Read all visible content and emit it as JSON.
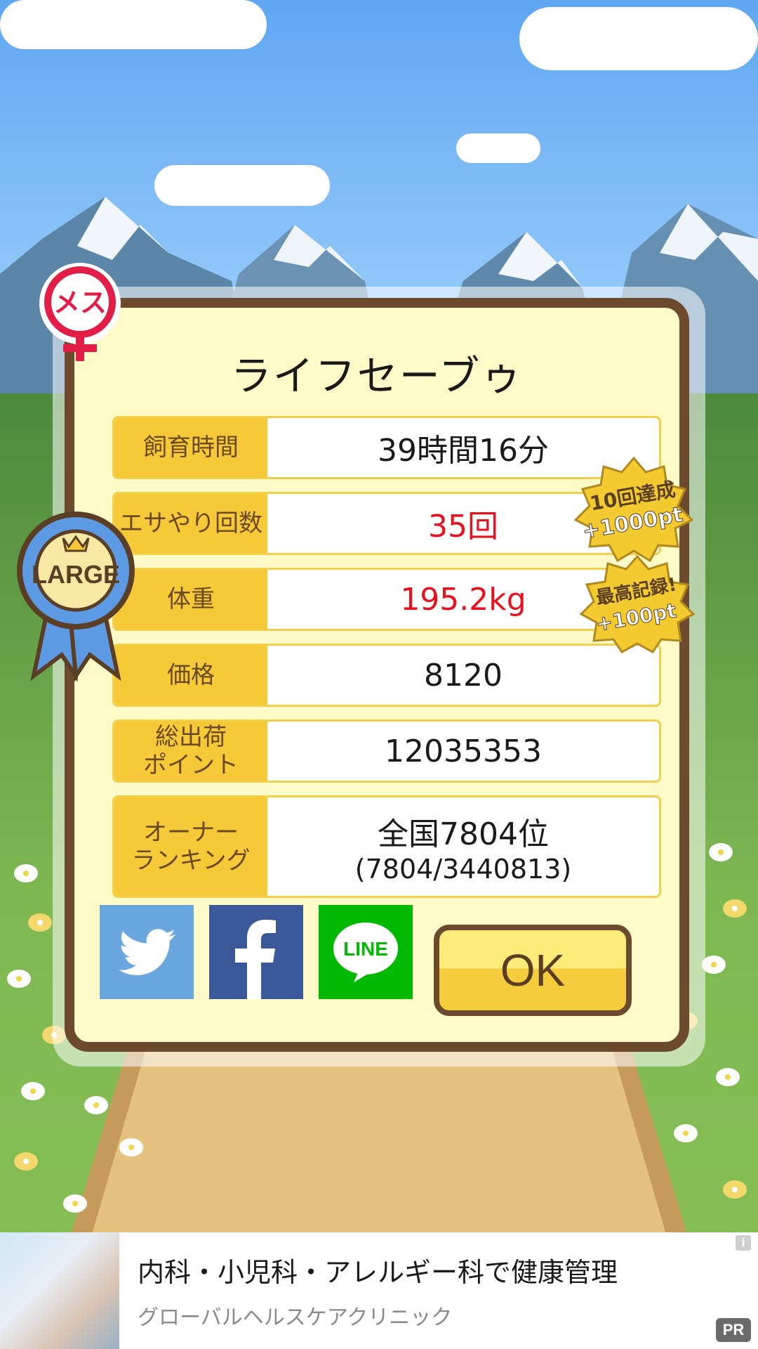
{
  "dialog": {
    "title": "ライフセーブゥ",
    "rows": [
      {
        "label": "飼育時間",
        "value": "39時間16分"
      },
      {
        "label": "エサやり回数",
        "value": "35回",
        "value_color": "#e8121e"
      },
      {
        "label": "体重",
        "value": "195.2kg",
        "value_color": "#e8121e"
      },
      {
        "label": "価格",
        "value": "8120"
      },
      {
        "label": "総出荷\nポイント",
        "value": "12035353"
      },
      {
        "label": "オーナー\nランキング",
        "value": "全国7804位",
        "value_line2": "(7804/3440813)"
      }
    ],
    "ok_label": "OK"
  },
  "badges": {
    "gender_label": "メス",
    "size_label": "LARGE",
    "bonus1": {
      "line1": "10回達成",
      "line2": "+1000pt"
    },
    "bonus2": {
      "line1": "最高記録!",
      "line2": "+100pt"
    }
  },
  "social": [
    {
      "name": "twitter",
      "color": "#6aa7df"
    },
    {
      "name": "facebook",
      "color": "#3b5998"
    },
    {
      "name": "line",
      "color": "#00b900",
      "text": "LINE"
    }
  ],
  "ad": {
    "title": "内科・小児科・アレルギー科で健康管理",
    "subtitle": "グローバルヘルスケアクリニック",
    "pr_label": "PR",
    "info_label": "i"
  },
  "colors": {
    "label_bg": "#f5c937",
    "dialog_bg": "#fffbc8",
    "frame": "#6b4a2e"
  }
}
